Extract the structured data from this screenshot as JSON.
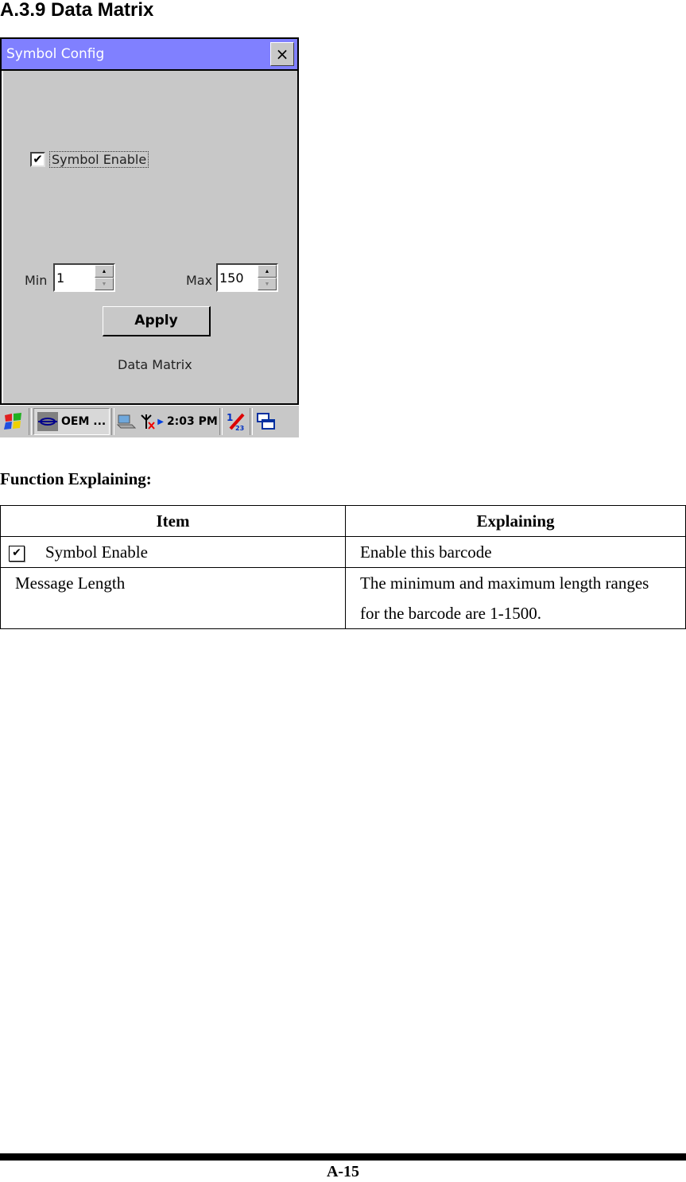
{
  "section_title": "A.3.9 Data Matrix",
  "dialog": {
    "title": "Symbol Config",
    "close_label": "×",
    "checkbox_label": "Symbol Enable",
    "checkbox_checked": true,
    "min_label": "Min",
    "min_value": "1",
    "max_label": "Max",
    "max_value": "150",
    "apply_label": "Apply",
    "caption": "Data Matrix"
  },
  "taskbar": {
    "start_icon": "windows-flag-icon",
    "app_button": "OEM ...",
    "clock": "2:03 PM",
    "input_icon": "input-panel-icon",
    "desktop_icon": "switch-windows-icon"
  },
  "function_title": "Function Explaining:",
  "table": {
    "headers": [
      "Item",
      "Explaining"
    ],
    "rows": [
      {
        "item": "Symbol Enable",
        "explaining": "Enable this barcode"
      },
      {
        "item": "Message Length",
        "explaining": "The minimum and maximum length ranges for the barcode are 1-1500."
      }
    ]
  },
  "page_number": "A-15"
}
